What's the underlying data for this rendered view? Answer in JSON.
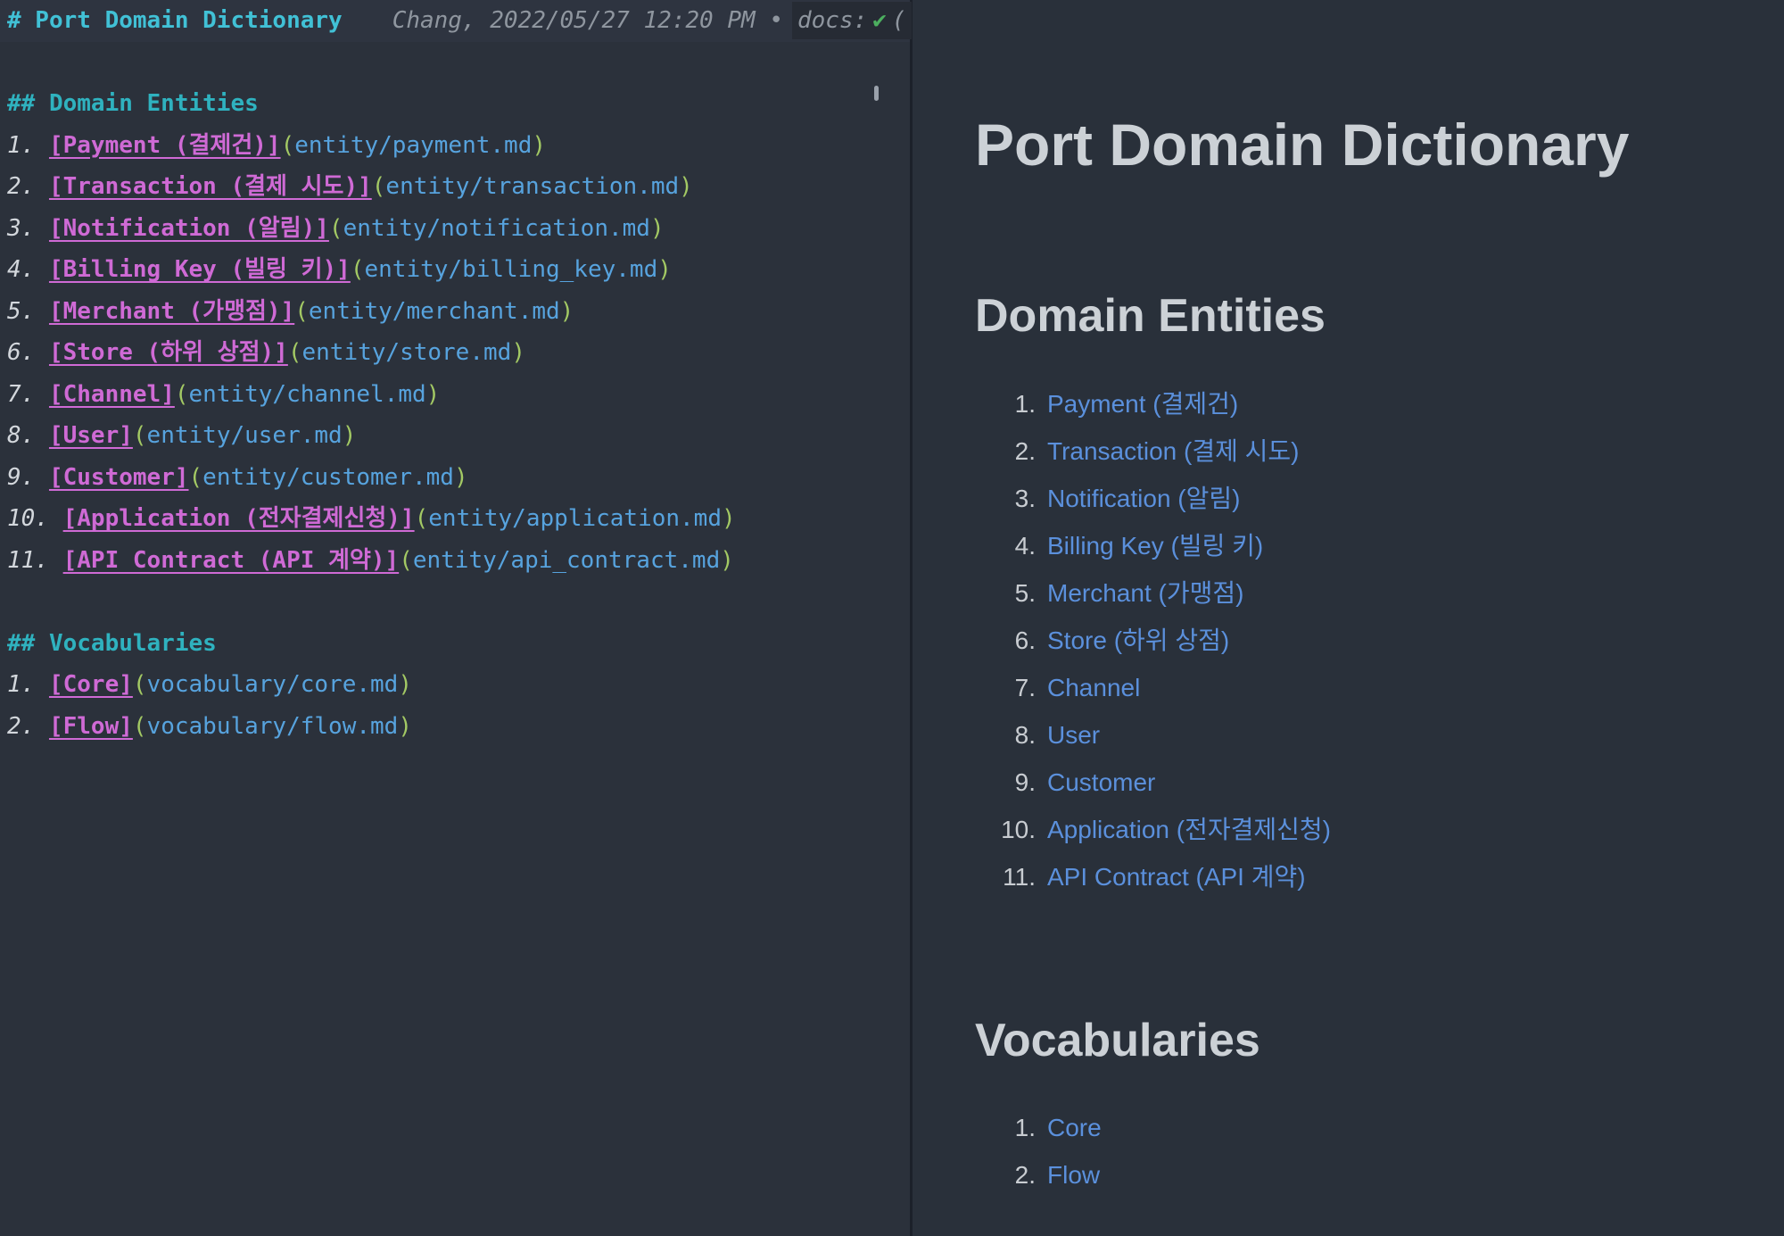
{
  "colors": {
    "editor_bg": "#2b313b",
    "preview_bg": "#29303a",
    "divider": "#1c212a",
    "heading_cyan": "#41c1d6",
    "heading_teal": "#2fb2bf",
    "link_magenta": "#cf6ad5",
    "paren_green": "#a3c964",
    "url_blue": "#57a3de",
    "meta_gray": "#8f969f",
    "check_green": "#4caf5f",
    "preview_heading_gray": "#ccd1d6",
    "preview_link_blue": "#5b90dc"
  },
  "editor": {
    "title_line": "# Port Domain Dictionary",
    "meta_text": "Chang, 2022/05/27 12:20 PM •",
    "docs_label": "docs:",
    "check_icon": "✔",
    "truncated_char": "(",
    "syntax": {
      "open_paren": "(",
      "close_paren": ")"
    },
    "sections": [
      {
        "heading": "## Domain Entities",
        "items": [
          {
            "num": "1.",
            "link": "[Payment (결제건)]",
            "url": "entity/payment.md"
          },
          {
            "num": "2.",
            "link": "[Transaction (결제 시도)]",
            "url": "entity/transaction.md"
          },
          {
            "num": "3.",
            "link": "[Notification (알림)]",
            "url": "entity/notification.md"
          },
          {
            "num": "4.",
            "link": "[Billing Key (빌링 키)]",
            "url": "entity/billing_key.md"
          },
          {
            "num": "5.",
            "link": "[Merchant (가맹점)]",
            "url": "entity/merchant.md"
          },
          {
            "num": "6.",
            "link": "[Store (하위 상점)]",
            "url": "entity/store.md"
          },
          {
            "num": "7.",
            "link": "[Channel]",
            "url": "entity/channel.md"
          },
          {
            "num": "8.",
            "link": "[User]",
            "url": "entity/user.md"
          },
          {
            "num": "9.",
            "link": "[Customer]",
            "url": "entity/customer.md"
          },
          {
            "num": "10.",
            "link": "[Application (전자결제신청)]",
            "url": "entity/application.md"
          },
          {
            "num": "11.",
            "link": "[API Contract (API 계약)]",
            "url": "entity/api_contract.md"
          }
        ]
      },
      {
        "heading": "## Vocabularies",
        "items": [
          {
            "num": "1.",
            "link": "[Core]",
            "url": "vocabulary/core.md"
          },
          {
            "num": "2.",
            "link": "[Flow]",
            "url": "vocabulary/flow.md"
          }
        ]
      }
    ]
  },
  "preview": {
    "title": "Port Domain Dictionary",
    "sections": [
      {
        "heading": "Domain Entities",
        "items": [
          {
            "num": "1.",
            "label": "Payment (결제건)"
          },
          {
            "num": "2.",
            "label": "Transaction (결제 시도)"
          },
          {
            "num": "3.",
            "label": "Notification (알림)"
          },
          {
            "num": "4.",
            "label": "Billing Key (빌링 키)"
          },
          {
            "num": "5.",
            "label": "Merchant (가맹점)"
          },
          {
            "num": "6.",
            "label": "Store (하위 상점)"
          },
          {
            "num": "7.",
            "label": "Channel"
          },
          {
            "num": "8.",
            "label": "User"
          },
          {
            "num": "9.",
            "label": "Customer"
          },
          {
            "num": "10.",
            "label": "Application (전자결제신청)"
          },
          {
            "num": "11.",
            "label": "API Contract (API 계약)"
          }
        ]
      },
      {
        "heading": "Vocabularies",
        "items": [
          {
            "num": "1.",
            "label": "Core"
          },
          {
            "num": "2.",
            "label": "Flow"
          }
        ]
      }
    ]
  }
}
